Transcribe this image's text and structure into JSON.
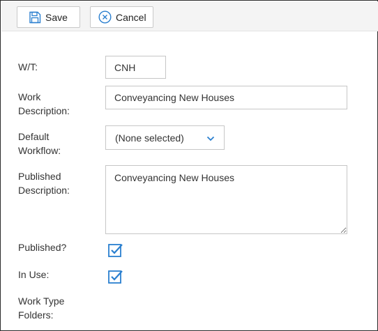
{
  "toolbar": {
    "save_label": "Save",
    "cancel_label": "Cancel"
  },
  "form": {
    "wt": {
      "label": "W/T:",
      "value": "CNH"
    },
    "work_description": {
      "label_line1": "Work",
      "label_line2": "Description:",
      "value": "Conveyancing New Houses"
    },
    "default_workflow": {
      "label_line1": "Default",
      "label_line2": "Workflow:",
      "selected": "(None selected)"
    },
    "published_description": {
      "label_line1": "Published",
      "label_line2": "Description:",
      "value": "Conveyancing New Houses"
    },
    "published": {
      "label": "Published?",
      "checked": true
    },
    "in_use": {
      "label": "In Use:",
      "checked": true
    },
    "work_type_folders": {
      "label_line1": "Work Type",
      "label_line2": "Folders:"
    }
  },
  "colors": {
    "accent": "#2a7fcf",
    "toolbar_bg": "#f4f4f4",
    "border": "#c6c6c6"
  },
  "icons": {
    "save": "floppy-disk-icon",
    "cancel": "circle-x-icon",
    "dropdown": "chevron-down-icon",
    "checkbox": "checkbox-checked-icon"
  }
}
